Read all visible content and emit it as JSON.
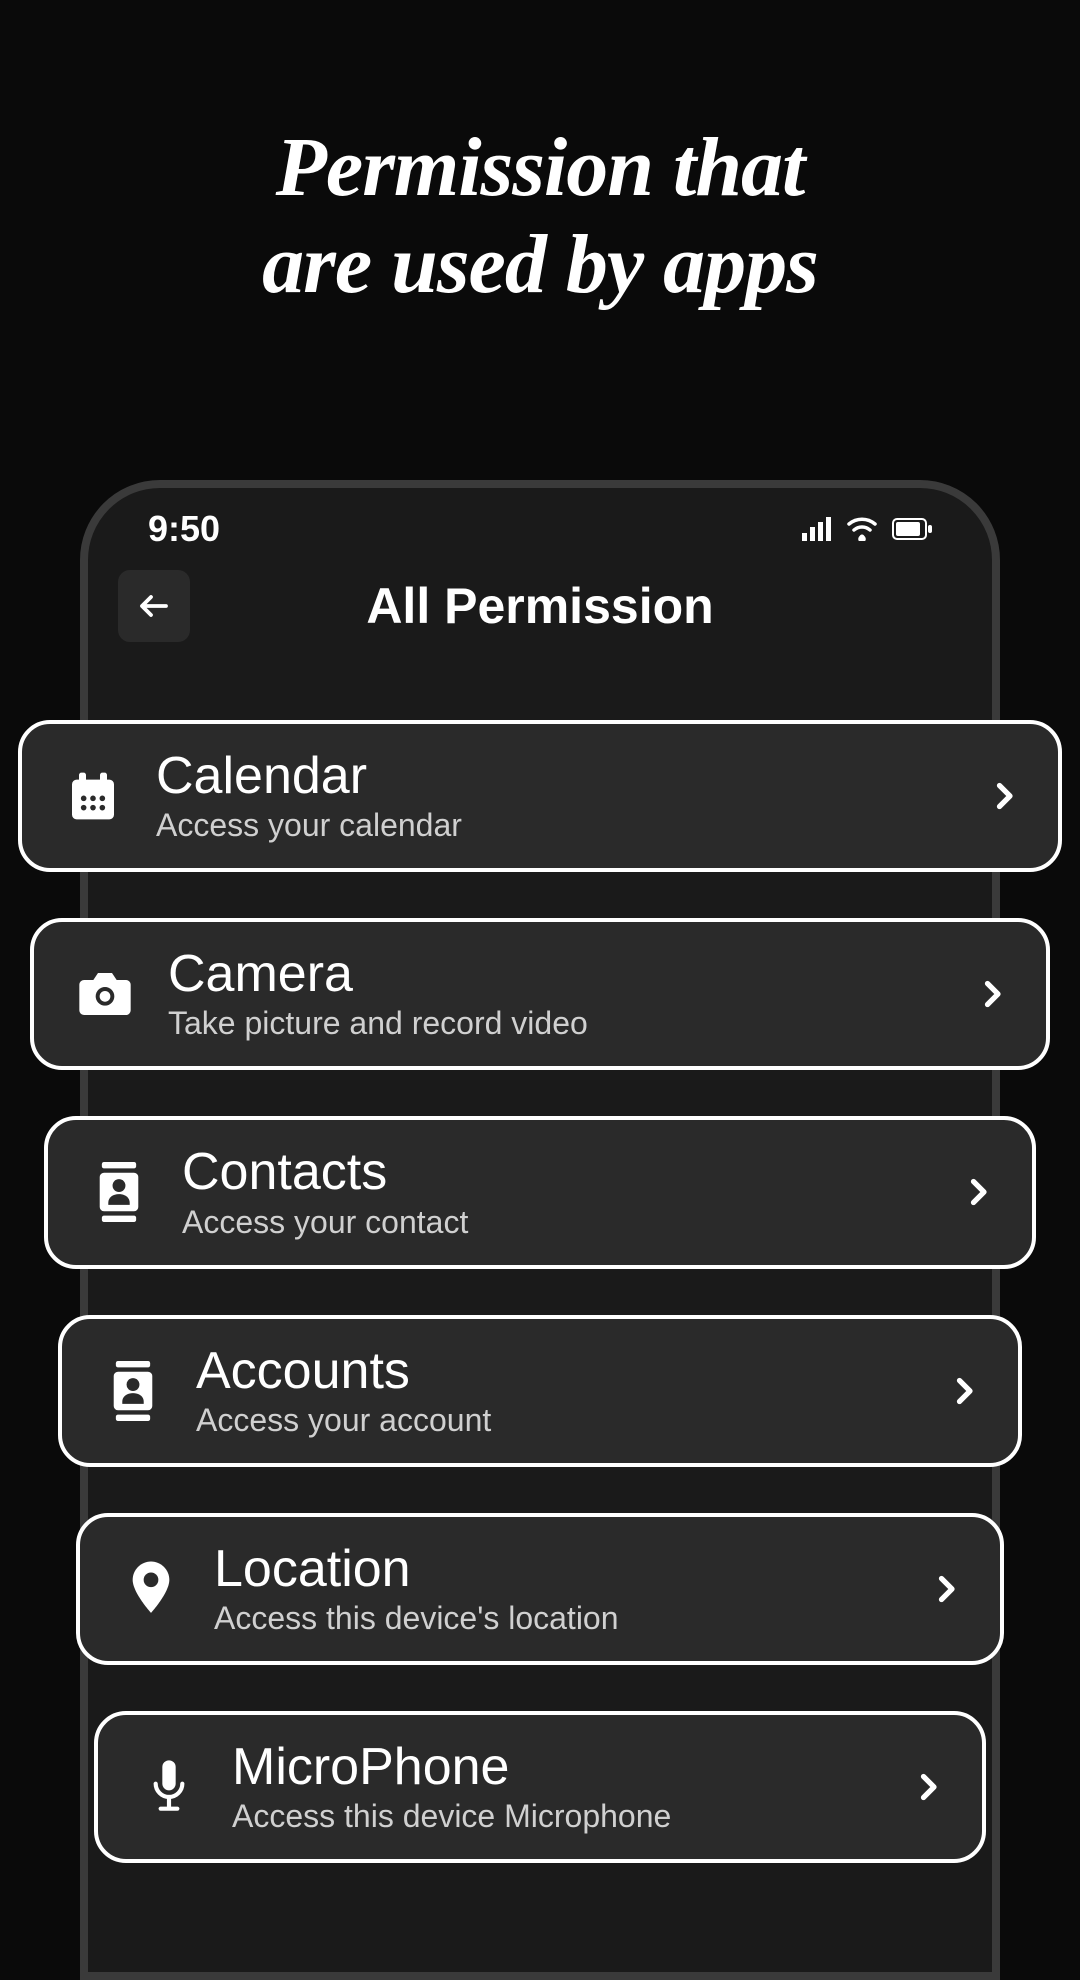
{
  "heading": {
    "line1": "Permission that",
    "line2": "are used by apps"
  },
  "statusBar": {
    "time": "9:50"
  },
  "header": {
    "title": "All Permission"
  },
  "permissions": [
    {
      "title": "Calendar",
      "subtitle": "Access your calendar",
      "icon": "calendar"
    },
    {
      "title": "Camera",
      "subtitle": "Take picture and record video",
      "icon": "camera"
    },
    {
      "title": "Contacts",
      "subtitle": "Access your contact",
      "icon": "contacts"
    },
    {
      "title": "Accounts",
      "subtitle": "Access your account",
      "icon": "accounts"
    },
    {
      "title": "Location",
      "subtitle": "Access this device's location",
      "icon": "location"
    },
    {
      "title": "MicroPhone",
      "subtitle": "Access this device Microphone",
      "icon": "microphone"
    }
  ]
}
